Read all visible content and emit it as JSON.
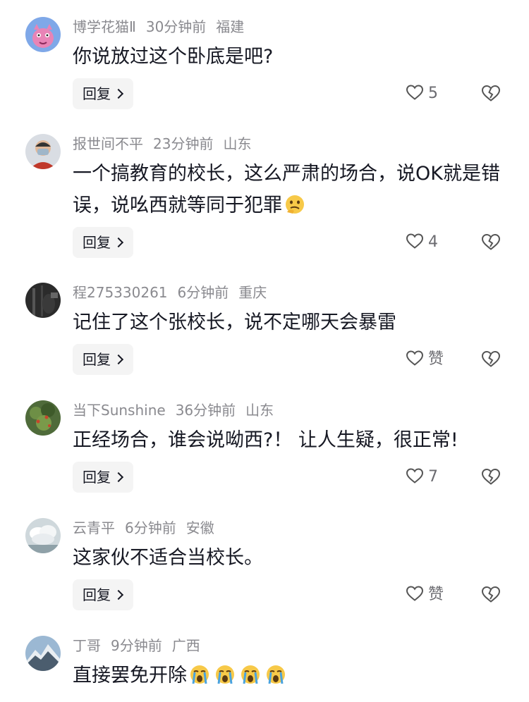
{
  "comments": [
    {
      "username": "博学花猫Ⅱ",
      "time": "30分钟前",
      "location": "福建",
      "text": "你说放过这个卧底是吧?",
      "likes": "5",
      "reply_label": "回复"
    },
    {
      "username": "报世间不平",
      "time": "23分钟前",
      "location": "山东",
      "text": "一个搞教育的校长，这么严肃的场合，说OK就是错误，说吆西就等同于犯罪",
      "likes": "4",
      "reply_label": "回复",
      "emoji": "thinking-face-emoji"
    },
    {
      "username": "程275330261",
      "time": "6分钟前",
      "location": "重庆",
      "text": "记住了这个张校长，说不定哪天会暴雷",
      "likes": "赞",
      "reply_label": "回复"
    },
    {
      "username": "当下Sunshine",
      "time": "36分钟前",
      "location": "山东",
      "text": "正经场合，谁会说呦西?！ 让人生疑，很正常!",
      "likes": "7",
      "reply_label": "回复"
    },
    {
      "username": "云青平",
      "time": "6分钟前",
      "location": "安徽",
      "text": "这家伙不适合当校长。",
      "likes": "赞",
      "reply_label": "回复"
    },
    {
      "username": "丁哥",
      "time": "9分钟前",
      "location": "广西",
      "text": "直接罢免开除",
      "emoji": "loudly-crying-face-emoji",
      "emoji_count": 4
    }
  ],
  "colors": {
    "text": "#161823",
    "meta": "#8a8a8f",
    "button_bg": "#f4f4f4"
  }
}
